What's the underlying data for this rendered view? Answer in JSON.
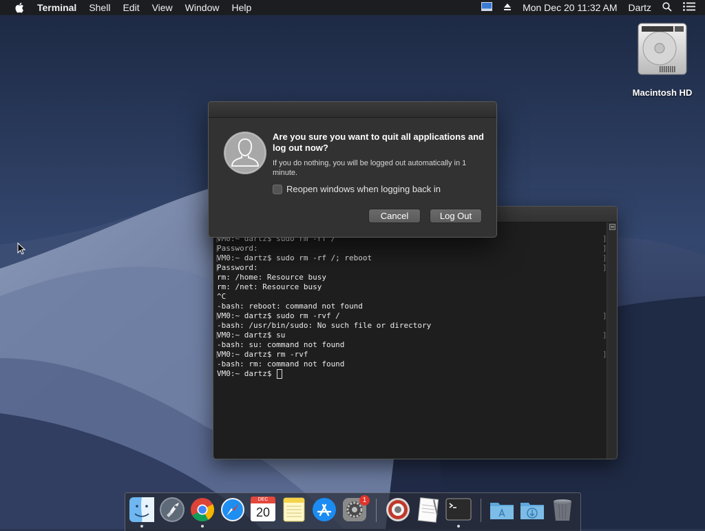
{
  "menubar": {
    "app_name": "Terminal",
    "menus": [
      "Shell",
      "Edit",
      "View",
      "Window",
      "Help"
    ],
    "clock": "Mon Dec 20  11:32 AM",
    "user": "Dartz"
  },
  "desktop": {
    "hd_label": "Macintosh HD"
  },
  "dialog": {
    "heading": "Are you sure you want to quit all applications and log out now?",
    "message": "If you do nothing, you will be logged out automatically in 1 minute.",
    "checkbox_label": "Reopen windows when logging back in",
    "checkbox_checked": false,
    "cancel_label": "Cancel",
    "logout_label": "Log Out"
  },
  "terminal": {
    "lines": [
      "VM0:~ dartz$ sudo rm -rf /",
      "Password:",
      "VM0:~ dartz$ sudo rm -rf /; reboot",
      "Password:",
      "rm: /home: Resource busy",
      "rm: /net: Resource busy",
      "^C",
      "-bash: reboot: command not found",
      "VM0:~ dartz$ sudo rm -rvf /",
      "-bash: /usr/bin/sudo: No such file or directory",
      "VM0:~ dartz$ su",
      "-bash: su: command not found",
      "VM0:~ dartz$ rm -rvf",
      "-bash: rm: command not found"
    ],
    "prompt": "VM0:~ dartz$ "
  },
  "dock": {
    "calendar_month": "DEC",
    "calendar_day": "20",
    "system_prefs_badge": "1",
    "items": [
      "finder-icon",
      "launchpad-icon",
      "chrome-icon",
      "safari-icon",
      "calendar-icon",
      "notes-icon",
      "app-store-icon",
      "system-preferences-icon",
      "photo-booth-icon",
      "textedit-icon",
      "terminal-icon",
      "applications-folder-icon",
      "downloads-folder-icon",
      "trash-icon"
    ]
  }
}
